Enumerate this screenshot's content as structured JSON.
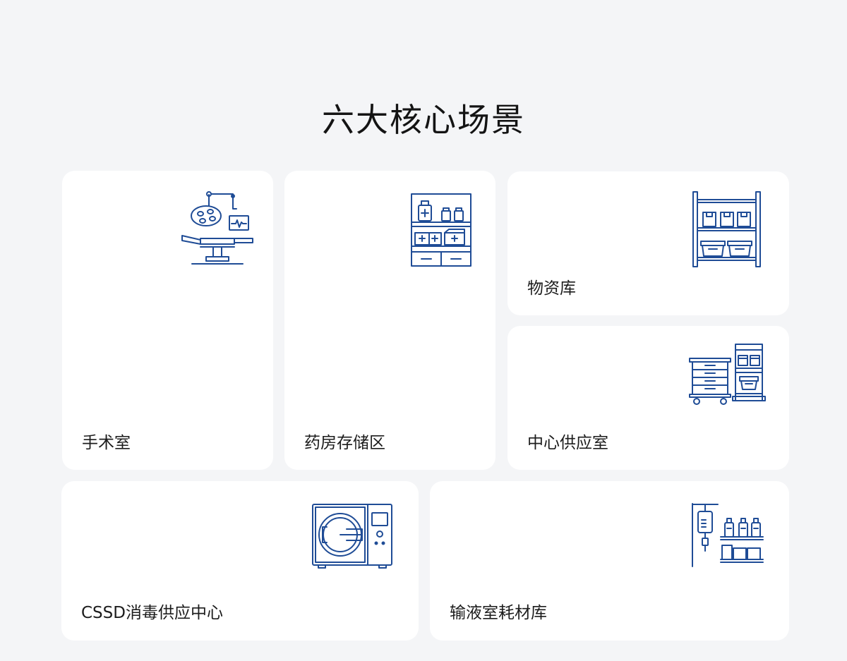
{
  "page": {
    "title": "六大核心场景"
  },
  "colors": {
    "background": "#f4f5f7",
    "card": "#ffffff",
    "icon_stroke": "#1f4c96",
    "text": "#1c1c1c"
  },
  "cards": [
    {
      "label": "手术室",
      "icon": "operating-room-icon"
    },
    {
      "label": "药房存储区",
      "icon": "pharmacy-cabinet-icon"
    },
    {
      "label": "物资库",
      "icon": "storage-shelf-icon"
    },
    {
      "label": "中心供应室",
      "icon": "supply-cart-icon"
    },
    {
      "label": "CSSD消毒供应中心",
      "icon": "sterilizer-icon"
    },
    {
      "label": "输液室耗材库",
      "icon": "iv-drip-supplies-icon"
    }
  ]
}
